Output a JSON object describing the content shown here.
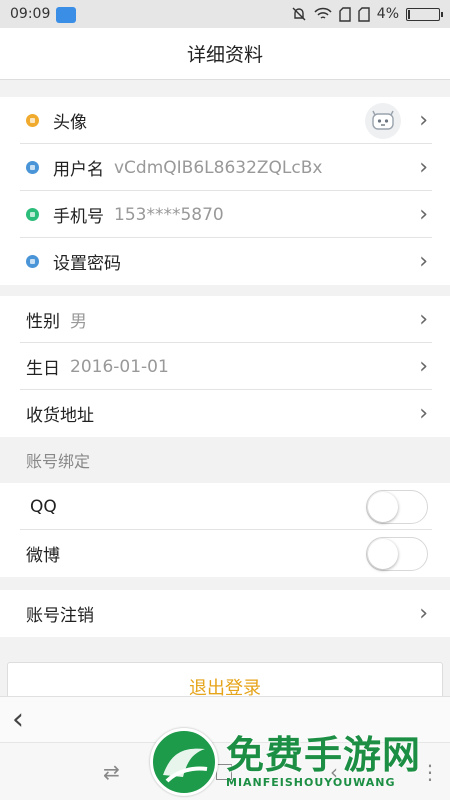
{
  "status": {
    "time": "09:09",
    "battery": "4%"
  },
  "title": "详细资料",
  "profile": [
    {
      "label": "头像",
      "value": "",
      "icon_color": "#f0ab2e",
      "icon": "avatar-icon"
    },
    {
      "label": "用户名",
      "value": "vCdmQIB6L8632ZQLcBx",
      "icon_color": "#4a94d8",
      "icon": "user-icon"
    },
    {
      "label": "手机号",
      "value": "153****5870",
      "icon_color": "#2dbd7a",
      "icon": "phone-icon"
    },
    {
      "label": "设置密码",
      "value": "",
      "icon_color": "#4a94d8",
      "icon": "lock-icon"
    }
  ],
  "info": [
    {
      "label": "性别",
      "value": "男"
    },
    {
      "label": "生日",
      "value": "2016-01-01"
    },
    {
      "label": "收货地址",
      "value": ""
    }
  ],
  "binding": {
    "section_title": "账号绑定",
    "items": [
      {
        "label": "QQ",
        "enabled": false
      },
      {
        "label": "微博",
        "enabled": false
      }
    ]
  },
  "cancel_account": "账号注销",
  "logout": "退出登录",
  "chevron": "›",
  "back": "‹",
  "watermark": {
    "cn": "免费手游网",
    "en": "MIANFEISHOUYOUWANG"
  }
}
